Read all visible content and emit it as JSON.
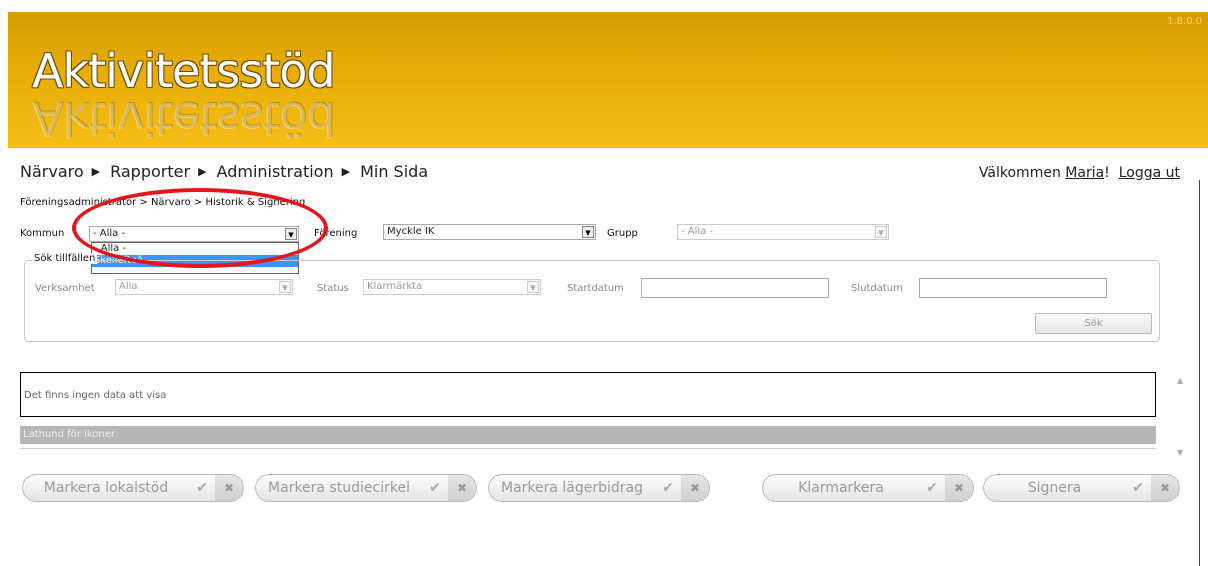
{
  "header": {
    "version": "1.8.0.0",
    "logo": "Aktivitetsstöd"
  },
  "nav": {
    "items": [
      "Närvaro",
      "Rapporter",
      "Administration",
      "Min Sida"
    ]
  },
  "welcome": {
    "prefix": "Välkommen ",
    "user": "Maria",
    "suffix": "!",
    "logout": "Logga ut"
  },
  "breadcrumb": "Föreningsadministratör > Närvaro > Historik & Signering",
  "filters": {
    "kommun_label": "Kommun",
    "kommun_value": "- Alla -",
    "kommun_options": [
      "- Alla -",
      "Skellefteå"
    ],
    "forening_label": "Förening",
    "forening_value": "Myckle IK",
    "grupp_label": "Grupp",
    "grupp_value": "- Alla -"
  },
  "search": {
    "legend": "Sök tillfällen",
    "verksamhet_label": "Verksamhet",
    "verksamhet_value": "Alla",
    "status_label": "Status",
    "status_value": "Klarmärkta",
    "startdatum_label": "Startdatum",
    "slutdatum_label": "Slutdatum",
    "sok_button": "Sök"
  },
  "grid": {
    "empty_text": "Det finns ingen data att visa",
    "lathund": "Lathund för ikoner"
  },
  "actions": [
    {
      "label": "Markera lokalstöd"
    },
    {
      "label": "Markera studiecirkel"
    },
    {
      "label": "Markera lägerbidrag"
    },
    {
      "label": "Klarmarkera"
    },
    {
      "label": "Signera"
    }
  ],
  "colors": {
    "header_top": "#d59d00",
    "header_bottom": "#f6be17",
    "highlight": "#e5161b"
  }
}
